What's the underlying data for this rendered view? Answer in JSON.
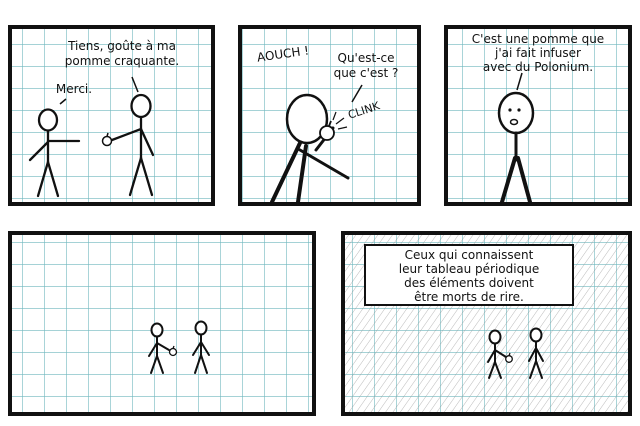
{
  "panels": [
    {
      "lines": [
        "Tiens, goûte à ma",
        "pomme craquante."
      ],
      "reply": "Merci."
    },
    {
      "exclamation": "AOUCH !",
      "question": [
        "Qu'est-ce",
        "que c'est ?"
      ],
      "sound": "CLINK"
    },
    {
      "lines": [
        "C'est une pomme que",
        "j'ai fait infuser",
        "avec du Polonium."
      ]
    },
    {},
    {
      "caption": [
        "Ceux qui connaissent",
        "leur tableau périodique",
        "des éléments doivent",
        "être morts de rire."
      ]
    }
  ],
  "colors": {
    "ink": "#111111",
    "grid": "#6fb7be",
    "paper": "#ffffff"
  }
}
